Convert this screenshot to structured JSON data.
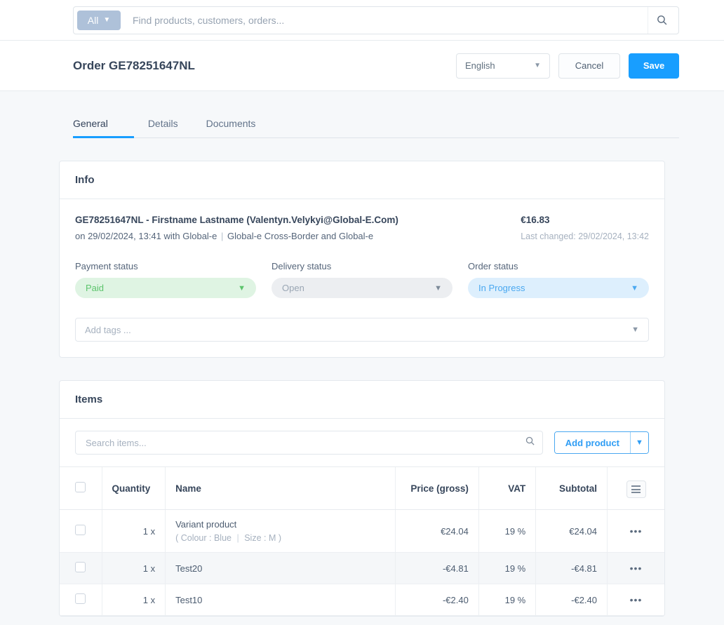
{
  "topbar": {
    "scope_label": "All",
    "scope_caret_icon": "chevron-down-icon",
    "search_placeholder": "Find products, customers, orders...",
    "search_value": "",
    "search_icon": "search-icon"
  },
  "header": {
    "title": "Order GE78251647NL",
    "language_value": "English",
    "language_caret_icon": "chevron-down-icon",
    "cancel_label": "Cancel",
    "save_label": "Save"
  },
  "tabs": [
    {
      "label": "General",
      "active": true
    },
    {
      "label": "Details",
      "active": false
    },
    {
      "label": "Documents",
      "active": false
    }
  ],
  "info": {
    "card_title": "Info",
    "summary_line": "GE78251647NL - Firstname Lastname (Valentyn.Velykyi@Global-E.Com)",
    "amount": "€16.83",
    "meta_prefix": "on 29/02/2024, 13:41 with Global-e",
    "meta_separator": "|",
    "meta_suffix": "Global-e Cross-Border and Global-e",
    "last_changed": "Last changed: 29/02/2024, 13:42",
    "statuses": [
      {
        "label": "Payment status",
        "value": "Paid",
        "style": "pill-green",
        "caret_icon": "chevron-down-icon"
      },
      {
        "label": "Delivery status",
        "value": "Open",
        "style": "pill-gray",
        "caret_icon": "chevron-down-icon"
      },
      {
        "label": "Order status",
        "value": "In Progress",
        "style": "pill-blue",
        "caret_icon": "chevron-down-icon"
      }
    ],
    "tags_placeholder": "Add tags ...",
    "tags_caret_icon": "chevron-down-icon"
  },
  "items": {
    "card_title": "Items",
    "search_placeholder": "Search items...",
    "search_value": "",
    "search_icon": "search-icon",
    "add_product_label": "Add product",
    "add_product_caret_icon": "chevron-down-icon",
    "columns": {
      "quantity": "Quantity",
      "name": "Name",
      "price": "Price (gross)",
      "vat": "VAT",
      "subtotal": "Subtotal",
      "menu_icon": "hamburger-icon"
    },
    "rows": [
      {
        "quantity": "1 x",
        "name": "Variant product",
        "variant_open": "( Colour : Blue",
        "variant_sep": "|",
        "variant_close": "Size : M )",
        "price": "€24.04",
        "vat": "19 %",
        "subtotal": "€24.04",
        "menu": "•••"
      },
      {
        "quantity": "1 x",
        "name": "Test20",
        "variant_open": "",
        "variant_sep": "",
        "variant_close": "",
        "price": "-€4.81",
        "vat": "19 %",
        "subtotal": "-€4.81",
        "menu": "•••"
      },
      {
        "quantity": "1 x",
        "name": "Test10",
        "variant_open": "",
        "variant_sep": "",
        "variant_close": "",
        "price": "-€2.40",
        "vat": "19 %",
        "subtotal": "-€2.40",
        "menu": "•••"
      }
    ]
  },
  "colors": {
    "accent": "#189eff",
    "page_bg": "#f6f8fa",
    "status_paid_bg": "#dff4e3",
    "status_paid_fg": "#5cc46c",
    "status_open_bg": "#eceef1",
    "status_open_fg": "#9aa6b4",
    "status_progress_bg": "#ddeffd",
    "status_progress_fg": "#4aa8f0"
  }
}
